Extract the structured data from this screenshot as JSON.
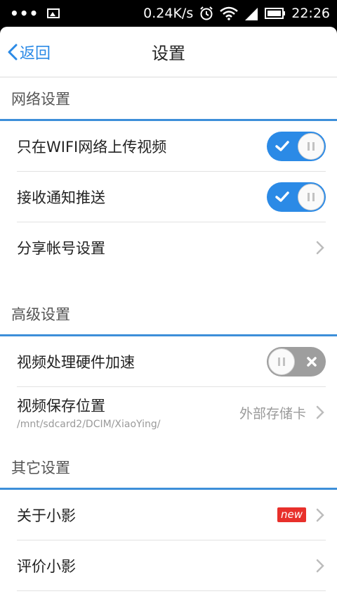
{
  "status_bar": {
    "dots": "•••",
    "network_speed": "0.24K/s",
    "time": "22:26"
  },
  "nav": {
    "back_label": "返回",
    "title": "设置"
  },
  "sections": {
    "network": {
      "header": "网络设置",
      "wifi_upload": {
        "label": "只在WIFI网络上传视频",
        "enabled": true
      },
      "push": {
        "label": "接收通知推送",
        "enabled": true
      },
      "share": {
        "label": "分享帐号设置"
      }
    },
    "advanced": {
      "header": "高级设置",
      "hw_accel": {
        "label": "视频处理硬件加速",
        "enabled": false
      },
      "save_location": {
        "label": "视频保存位置",
        "path": "/mnt/sdcard2/DCIM/XiaoYing/",
        "value": "外部存储卡"
      }
    },
    "other": {
      "header": "其它设置",
      "about": {
        "label": "关于小影",
        "badge": "new"
      },
      "rate": {
        "label": "评价小影"
      }
    }
  },
  "colors": {
    "accent": "#2b8ae6",
    "section_line": "#3d8fd9",
    "badge": "#e8302b",
    "toggle_off": "#9e9e9e"
  }
}
